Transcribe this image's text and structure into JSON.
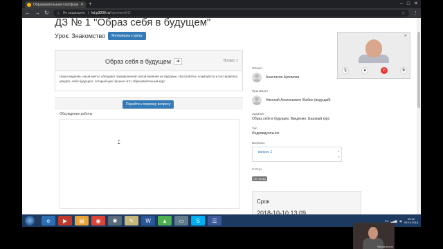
{
  "browser": {
    "tab_title": "Образовательная платформа ✕",
    "tab_title_short": "Образовательная платформа",
    "security_label": "Не защищено",
    "url_host": "kd.p3000.ru",
    "url_path": "/homework/1/"
  },
  "page": {
    "title": "ДЗ № 1 \"Образ себя в будущем\"",
    "lesson_label": "Урок: Знакомство",
    "lesson_materials_button": "Материалы к уроку",
    "question_card": {
      "title": "Образ себя в будущем",
      "next_arrow": "➔",
      "question_number": "Вопрос 1",
      "description": "Наше видение, наши мечты обладают определенной силой влияния на будущее. Настройтесь пожалуйста и постарайтесь увидеть себя будущего, который уже прошел этот образовательный курс."
    },
    "go_first_question_button": "Перейти к первому вопросу",
    "discussion_label": "Обсуждение работы"
  },
  "sidebar": {
    "object_label": "Объект",
    "object_name": "Анастасия Артемова",
    "acceptor_label": "Принимает",
    "acceptor_name": "Николай Анатольевич Жабин (ведущий)",
    "task_label": "Задание",
    "task_value": "Образ себя в будущем, Введение, Базовый курс",
    "type_label": "Тип",
    "type_value": "Индивидуальное",
    "questions_label": "Вопросы",
    "question_link": "вопрос 1",
    "status_label": "Статус",
    "status_value": "Не готово",
    "deadline_title": "Срок",
    "deadline_value": "2018-10-10 13:09"
  },
  "taskbar": {
    "clock_time": "20:12",
    "clock_date": "06.10.2018",
    "presenter_name": "Mikhail Artunin"
  },
  "colors": {
    "primary": "#337ab7",
    "status_badge": "#777777",
    "end_call": "#e53935"
  }
}
